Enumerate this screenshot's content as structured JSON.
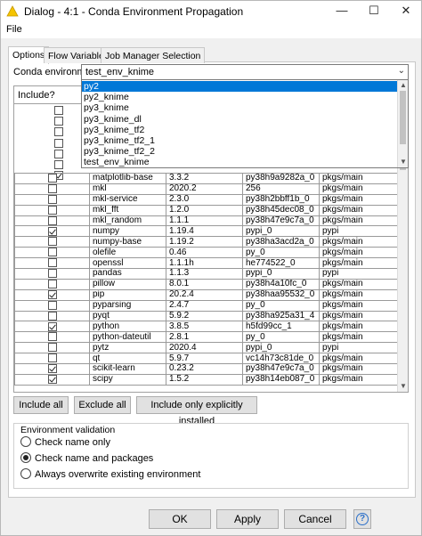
{
  "window": {
    "title": "Dialog - 4:1 - Conda Environment Propagation"
  },
  "menu": {
    "file": "File"
  },
  "tabs": [
    {
      "label": "Options"
    },
    {
      "label": "Flow Variables"
    },
    {
      "label": "Job Manager Selection"
    }
  ],
  "env": {
    "label": "Conda environment",
    "selected": "test_env_knime",
    "options": [
      "py2",
      "py2_knime",
      "py3_knime",
      "py3_knime_dl",
      "py3_knime_tf2",
      "py3_knime_tf2_1",
      "py3_knime_tf2_2",
      "test_env_knime"
    ],
    "highlighted": "py2"
  },
  "table": {
    "header_include": "Include?",
    "hidden_checks": [
      false,
      false,
      false,
      false,
      false,
      false,
      true
    ],
    "rows": [
      {
        "include": false,
        "name": "matplotlib-base",
        "version": "3.3.2",
        "build": "py38h9a9282a_0",
        "channel": "pkgs/main"
      },
      {
        "include": false,
        "name": "mkl",
        "version": "2020.2",
        "build": "256",
        "channel": "pkgs/main"
      },
      {
        "include": false,
        "name": "mkl-service",
        "version": "2.3.0",
        "build": "py38h2bbff1b_0",
        "channel": "pkgs/main"
      },
      {
        "include": false,
        "name": "mkl_fft",
        "version": "1.2.0",
        "build": "py38h45dec08_0",
        "channel": "pkgs/main"
      },
      {
        "include": false,
        "name": "mkl_random",
        "version": "1.1.1",
        "build": "py38h47e9c7a_0",
        "channel": "pkgs/main"
      },
      {
        "include": true,
        "name": "numpy",
        "version": "1.19.4",
        "build": "pypi_0",
        "channel": "pypi"
      },
      {
        "include": false,
        "name": "numpy-base",
        "version": "1.19.2",
        "build": "py38ha3acd2a_0",
        "channel": "pkgs/main"
      },
      {
        "include": false,
        "name": "olefile",
        "version": "0.46",
        "build": "py_0",
        "channel": "pkgs/main"
      },
      {
        "include": false,
        "name": "openssl",
        "version": "1.1.1h",
        "build": "he774522_0",
        "channel": "pkgs/main"
      },
      {
        "include": false,
        "name": "pandas",
        "version": "1.1.3",
        "build": "pypi_0",
        "channel": "pypi"
      },
      {
        "include": false,
        "name": "pillow",
        "version": "8.0.1",
        "build": "py38h4a10fc_0",
        "channel": "pkgs/main"
      },
      {
        "include": true,
        "name": "pip",
        "version": "20.2.4",
        "build": "py38haa95532_0",
        "channel": "pkgs/main"
      },
      {
        "include": false,
        "name": "pyparsing",
        "version": "2.4.7",
        "build": "py_0",
        "channel": "pkgs/main"
      },
      {
        "include": false,
        "name": "pyqt",
        "version": "5.9.2",
        "build": "py38ha925a31_4",
        "channel": "pkgs/main"
      },
      {
        "include": true,
        "name": "python",
        "version": "3.8.5",
        "build": "h5fd99cc_1",
        "channel": "pkgs/main"
      },
      {
        "include": false,
        "name": "python-dateutil",
        "version": "2.8.1",
        "build": "py_0",
        "channel": "pkgs/main"
      },
      {
        "include": false,
        "name": "pytz",
        "version": "2020.4",
        "build": "pypi_0",
        "channel": "pypi"
      },
      {
        "include": false,
        "name": "qt",
        "version": "5.9.7",
        "build": "vc14h73c81de_0",
        "channel": "pkgs/main"
      },
      {
        "include": true,
        "name": "scikit-learn",
        "version": "0.23.2",
        "build": "py38h47e9c7a_0",
        "channel": "pkgs/main"
      },
      {
        "include": true,
        "name": "scipy",
        "version": "1.5.2",
        "build": "py38h14eb087_0",
        "channel": "pkgs/main"
      }
    ]
  },
  "buttons": {
    "include_all": "Include all",
    "exclude_all": "Exclude all",
    "include_explicit": "Include only explicitly installed"
  },
  "validation": {
    "title": "Environment validation",
    "options": [
      {
        "label": "Check name only",
        "selected": false
      },
      {
        "label": "Check name and packages",
        "selected": true
      },
      {
        "label": "Always overwrite existing environment",
        "selected": false
      }
    ]
  },
  "footer": {
    "ok": "OK",
    "apply": "Apply",
    "cancel": "Cancel"
  }
}
